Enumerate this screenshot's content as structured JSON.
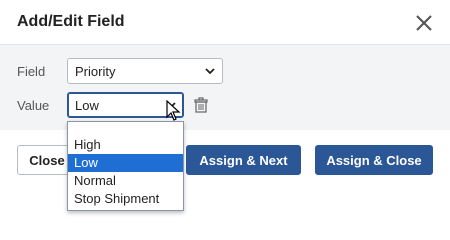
{
  "dialog": {
    "title": "Add/Edit Field",
    "close_icon": "close-icon"
  },
  "form": {
    "field_label": "Field",
    "field_value": "Priority",
    "value_label": "Value",
    "value_value": "Low",
    "delete_icon": "trash-icon"
  },
  "dropdown": {
    "options": [
      "High",
      "Low",
      "Normal",
      "Stop Shipment"
    ],
    "selected": "Low"
  },
  "buttons": {
    "close_label": "Close",
    "assign_next_label": "Assign & Next",
    "assign_close_label": "Assign & Close"
  },
  "colors": {
    "primary": "#2b5797",
    "highlight": "#1f6ed4",
    "body_bg": "#f3f4f5"
  }
}
